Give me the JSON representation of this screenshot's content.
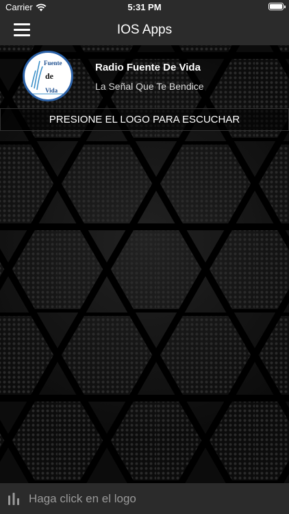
{
  "status_bar": {
    "carrier": "Carrier",
    "time": "5:31 PM"
  },
  "nav": {
    "title": "IOS Apps"
  },
  "station": {
    "name": "Radio Fuente De Vida",
    "slogan": "La Señal Que Te Bendice",
    "logo_text": {
      "top": "Fuente",
      "middle": "de",
      "bottom": "Vida"
    }
  },
  "banner": {
    "text": "PRESIONE EL LOGO PARA ESCUCHAR"
  },
  "player": {
    "status_text": "Haga click en el logo"
  },
  "colors": {
    "bar_bg": "#2b2b2b",
    "content_bg": "#111111",
    "logo_ring": "#2c62a8"
  },
  "icons": {
    "menu": "hamburger-icon",
    "wifi": "wifi-icon",
    "battery": "battery-icon",
    "player": "equalizer-bars-icon"
  }
}
